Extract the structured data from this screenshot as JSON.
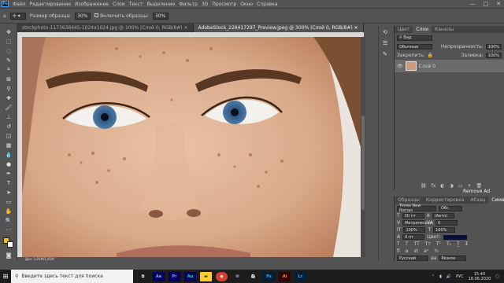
{
  "menu": {
    "app_badge": "Ps",
    "items": [
      "Файл",
      "Редактирование",
      "Изображение",
      "Слои",
      "Текст",
      "Выделение",
      "Фильтр",
      "3D",
      "Просмотр",
      "Окно",
      "Справка"
    ],
    "win_min": "—",
    "win_max": "□",
    "win_close": "✕"
  },
  "options": {
    "size_label": "Размер образца:",
    "size_value": "30%",
    "overlay_label": "Включить образцы:",
    "overlay_value": "30%"
  },
  "tabs": [
    {
      "label": "stockphoto-1173638445-1024x1024.jpg @ 100% (Слой 0, RGB/8#)",
      "close": "✕"
    },
    {
      "label": "AdobeStock_226417297_Preview.jpeg @ 300% (Слой 0, RGB/8#)",
      "close": "✕"
    }
  ],
  "status": {
    "text": "Док: 1,91M/1,91M"
  },
  "layers_panel": {
    "tabs": [
      "Цвет",
      "Слои",
      "Каналы"
    ],
    "filter": "Вид",
    "blend": "Обычные",
    "opacity_label": "Непрозрачность:",
    "opacity": "100%",
    "lock_label": "Закрепить:",
    "fill_label": "Заливка:",
    "fill": "100%",
    "layer_name": "Слой 0"
  },
  "char_panel": {
    "tabs": [
      "Образцы",
      "Корректировка",
      "Абзац",
      "Символ"
    ],
    "font": "Times New Roman",
    "style": "Обс",
    "size": "30 пт",
    "leading": "(Авто)",
    "tracking": "0",
    "kern": "Метрическая",
    "vscale": "100%",
    "hscale": "100%",
    "baseline": "0 пт",
    "color_label": "Цвет:",
    "lang": "Русский",
    "aa": "Резкое"
  },
  "taskbar": {
    "search_placeholder": "Введите здесь текст для поиска",
    "lang": "РУС",
    "time": "15:40",
    "date": "18.06.2020",
    "apps": [
      {
        "label": "Ae",
        "bg": "#00005b",
        "fg": "#9999ff"
      },
      {
        "label": "Pr",
        "bg": "#00005b",
        "fg": "#9999ff"
      },
      {
        "label": "Au",
        "bg": "#00005b",
        "fg": "#00e4bb"
      },
      {
        "label": "Ps",
        "bg": "#001e36",
        "fg": "#31a8ff"
      },
      {
        "label": "Ai",
        "bg": "#330000",
        "fg": "#ff9a00"
      },
      {
        "label": "Lr",
        "bg": "#001e36",
        "fg": "#31a8ff"
      }
    ]
  },
  "watermark": "Remove Ad"
}
